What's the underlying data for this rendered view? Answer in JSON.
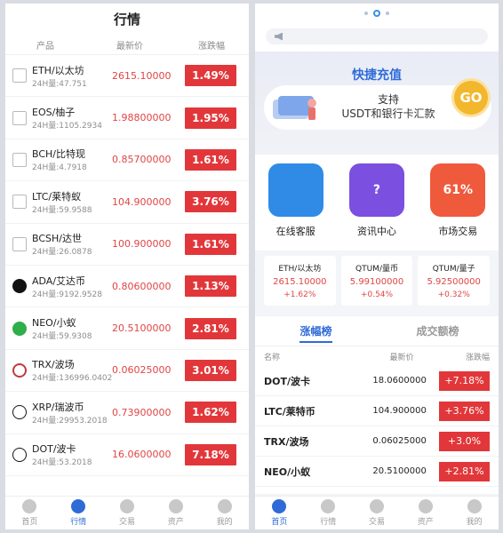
{
  "left": {
    "title": "行情",
    "headers": {
      "product": "产品",
      "price": "最新价",
      "change": "涨跌幅"
    },
    "rows": [
      {
        "name": "ETH/以太坊",
        "vol": "24H量:47.751",
        "price": "2615.10000",
        "change": "1.49%"
      },
      {
        "name": "EOS/柚子",
        "vol": "24H量:1105.2934",
        "price": "1.98800000",
        "change": "1.95%"
      },
      {
        "name": "BCH/比特现",
        "vol": "24H量:4.7918",
        "price": "0.85700000",
        "change": "1.61%"
      },
      {
        "name": "LTC/莱特蚁",
        "vol": "24H量:59.9588",
        "price": "104.900000",
        "change": "3.76%"
      },
      {
        "name": "BCSH/达世",
        "vol": "24H量:26.0878",
        "price": "100.900000",
        "change": "1.61%"
      },
      {
        "name": "ADA/艾达币",
        "vol": "24H量:9192.9528",
        "price": "0.80600000",
        "change": "1.13%"
      },
      {
        "name": "NEO/小蚁",
        "vol": "24H量:59.9308",
        "price": "20.5100000",
        "change": "2.81%"
      },
      {
        "name": "TRX/波场",
        "vol": "24H量:136996.0402",
        "price": "0.06025000",
        "change": "3.01%"
      },
      {
        "name": "XRP/瑞波币",
        "vol": "24H量:29953.2018",
        "price": "0.73900000",
        "change": "1.62%"
      },
      {
        "name": "DOT/波卡",
        "vol": "24H量:53.2018",
        "price": "16.0600000",
        "change": "7.18%"
      }
    ],
    "tabs": [
      "首页",
      "行情",
      "交易",
      "资产",
      "我的"
    ],
    "floating_price": "104.900000"
  },
  "right": {
    "charge": {
      "title": "快捷充值",
      "line1": "支持",
      "line2": "USDT和银行卡汇款",
      "go": "GO"
    },
    "quick": [
      {
        "label": "在线客服",
        "color": "#2f8be6",
        "glyph": ""
      },
      {
        "label": "资讯中心",
        "color": "#7b4fe0",
        "glyph": "?"
      },
      {
        "label": "市场交易",
        "color": "#f05a3c",
        "glyph": "61%"
      }
    ],
    "tickers": [
      {
        "name": "ETH/以太坊",
        "price": "2615.10000",
        "change": "+1.62%"
      },
      {
        "name": "QTUM/量币",
        "price": "5.99100000",
        "change": "+0.54%"
      },
      {
        "name": "QTUM/量子",
        "price": "5.92500000",
        "change": "+0.32%"
      }
    ],
    "rank_tabs": [
      "涨幅榜",
      "成交额榜"
    ],
    "rank_headers": {
      "name": "名称",
      "price": "最新价",
      "change": "涨跌幅"
    },
    "rank_rows": [
      {
        "name": "DOT/波卡",
        "price": "18.0600000",
        "change": "+7.18%"
      },
      {
        "name": "LTC/莱特币",
        "price": "104.900000",
        "change": "+3.76%"
      },
      {
        "name": "TRX/波场",
        "price": "0.06025000",
        "change": "+3.0%"
      },
      {
        "name": "NEO/小蚁",
        "price": "20.5100000",
        "change": "+2.81%"
      }
    ],
    "tabs": [
      "首页",
      "行情",
      "交易",
      "资产",
      "我的"
    ]
  }
}
